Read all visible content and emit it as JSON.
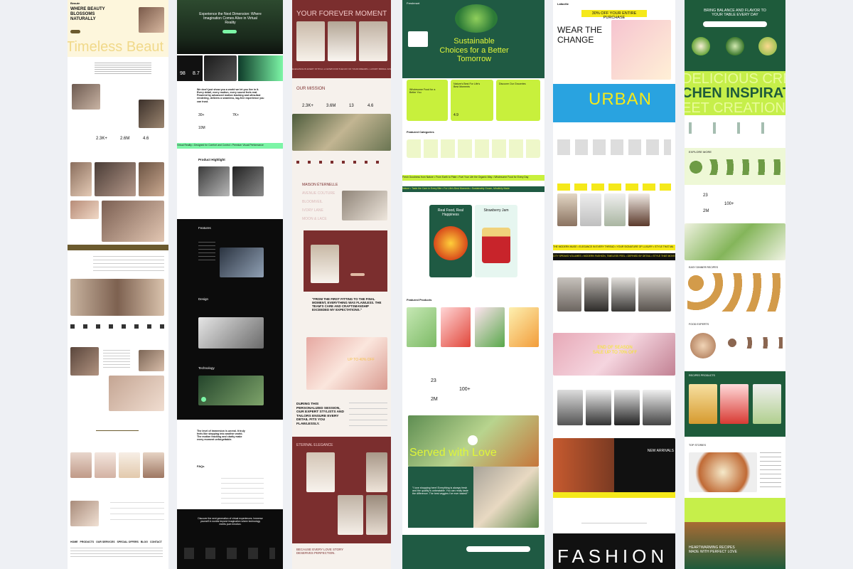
{
  "beauty": {
    "brand": "Beaute",
    "hero_title": "WHERE BEAUTY BLOSSOMS NATURALLY",
    "hero_big": "Timeless Beaut",
    "stats": [
      "2.3K+",
      "2.6M",
      "4.6"
    ],
    "footer_nav": [
      "HOME",
      "PRODUCTS",
      "OUR SERVICES",
      "SPECIAL OFFERS",
      "BLOG",
      "CONTACT"
    ],
    "accent": "#6b5a2e"
  },
  "vr": {
    "hero_title": "Experience the Next Dimension: Where Imagination Comes Alive in Virtual Reality",
    "stats": [
      "98",
      "8.7"
    ],
    "intro": "We don't just show you a world we let you live in it. Every detail, every motion, every sound feels real. Powered by advanced motion tracking and ultra-fast rendering, delivers a seamless, lag-free experience you can trust.",
    "stat_pairs": [
      "30+",
      "7K+",
      "10M"
    ],
    "marquee": "Virtual Reality • Designed for Comfort and Control • Premium Visual Performance",
    "section_product": "Product Highlight",
    "section_features": "Features",
    "section_design": "Design",
    "section_technology": "Technology",
    "quote": "The level of immersion is unreal. It truly feels like stepping into another world. The motion tracking and clarity make every moment unforgettable.",
    "faqs": "FAQs",
    "cta": "Discover the next generation of virtual experiences. Immerse yourself in worlds beyond imagination where technology meets pure emotion.",
    "accent": "#7cf5a6"
  },
  "wedding": {
    "hero_title": "YOUR FOREVER MOMENT",
    "marquee": "ELEGANCE IN EVERY STITCH • A GOWN FOR THE DAY OF YOUR DREAMS • LUXURY BRIDAL FASHION",
    "mission": "OUR MISSION",
    "stats": [
      "2.3K+",
      "3.6M",
      "13",
      "4.6"
    ],
    "collections": [
      "MAISON ÉTERNELLE",
      "AVENUE COUTURE",
      "BLOOMVEIL",
      "IVORY LANE",
      "MOON & LACE"
    ],
    "testimonial": "\"FROM THE FIRST FITTING TO THE FINAL MOMENT, EVERYTHING WAS FLAWLESS. THE TEAM'S CARE AND CRAFTSMANSHIP EXCEEDED MY EXPECTATIONS.\"",
    "sale": "UP TO 40% OFF",
    "session": "DURING THIS PERSONALIZED SESSION, OUR EXPERT STYLISTS AND TAILORS ENSURE EVERY DETAIL FITS YOU FLAWLESSLY.",
    "eternal": "ETERNAL ELEGANCE",
    "closing": "BECAUSE EVERY LOVE STORY DESERVES PERFECTION.",
    "accent": "#7b2e2e"
  },
  "grocery": {
    "brand": "Freshmart",
    "hero_title": "Sustainable Choices for a Better Tomorrow",
    "card_titles": [
      "Wholesome Food for a Better You",
      "Nature's Best For Life's Best Moments",
      "Discover Our Groceries"
    ],
    "card_stat": "4.9",
    "featured_categories": "Featured Categories",
    "marquee": "Fresh Goodness from Nature • From Earth to Plate • Fuel Your Life the Organic Way • Wholesome Food for Every Day",
    "marquee2": "Nature • Taste the Care in Every Bite • For Life's Best Moments • Sustainably Grown, Mindfully Made",
    "promo1": "Real Food, Real Happiness",
    "promo2": "Strawberry Jam",
    "featured_products": "Featured Products",
    "stats": [
      "23",
      "100+",
      "2M"
    ],
    "served": "Served with Love",
    "quote": "\"I love shopping here! Everything is always fresh and the quality is unbeatable. You can really taste the difference. The best veggies I've ever tasted!\"",
    "accent": "#1f5a43"
  },
  "fashion": {
    "brand": "Lafaville",
    "promo": "30% OFF YOUR ENTIRE PURCHASE",
    "hero_title": "WEAR THE CHANGE",
    "urban": "URBAN",
    "marquee": "CITY SPEAKS VOLUMES • MODERN FASHION, TIMELESS FEEL • DEFINED BY DETAIL • STYLE THAT MOVES",
    "marquee_top": "THE MODERN MUSE • ELEGANCE IN EVERY THREAD • YOUR SIGNATURE OF LUXURY • STYLE THAT MA",
    "sale": "END OF SEASON SALE UP TO 70% OFF",
    "arrivals": "NEW ARRIVALS",
    "footer_big": "FASHION",
    "accent": "#f5e91a"
  },
  "food": {
    "hero_title": "BRING BALANCE AND FLAVOR TO YOUR TABLE EVERY DAY",
    "big_text": [
      "DELICIOUS CRE",
      "CHEN INSPIRAT",
      "EET CREATION"
    ],
    "explore": "EXPLORE MORE",
    "stats": [
      "23",
      "100+",
      "2M"
    ],
    "easy": "EASY DINNER RECIPES",
    "experts": "FOOD EXPERTS",
    "recipes": "RECIPES PRODUCTS",
    "top": "TOP STORIES",
    "closing": "HEARTWARMING RECIPES MADE WITH PERFECT LOVE",
    "accent": "#c6ef4a"
  },
  "icons": {
    "play": "play-icon",
    "arrow": "arrow-right-icon",
    "cart": "cart-icon",
    "search": "search-icon"
  }
}
